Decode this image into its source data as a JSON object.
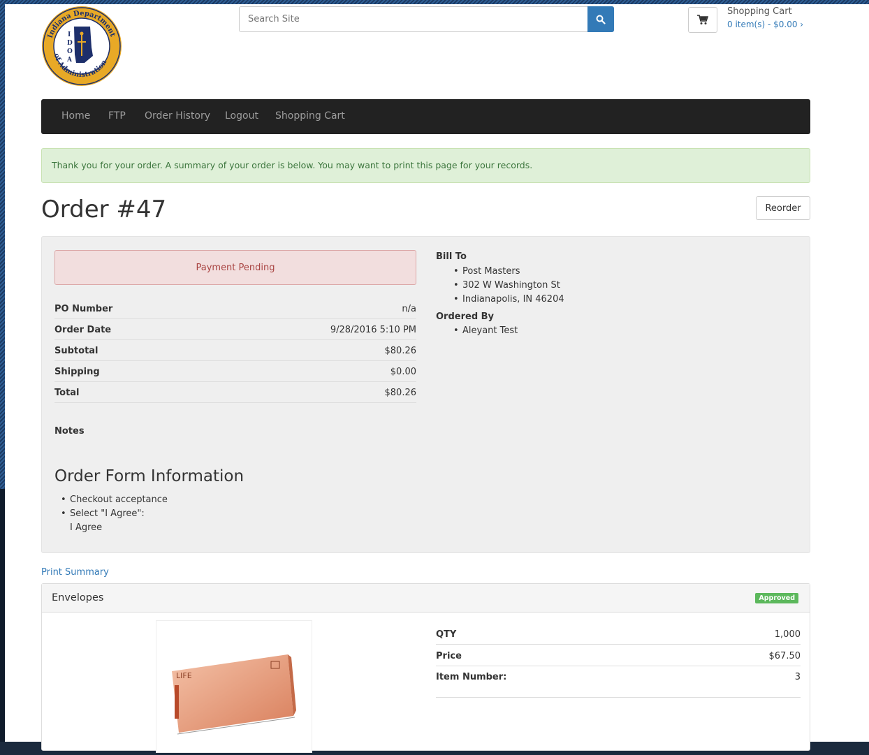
{
  "header": {
    "search_placeholder": "Search Site",
    "cart_title": "Shopping Cart",
    "cart_summary": "0 item(s) - $0.00 ›",
    "logo_text": "Indiana Department of Administration IDOA"
  },
  "nav": {
    "items": [
      {
        "label": "Home"
      },
      {
        "label": "FTP"
      },
      {
        "label": "Order History"
      },
      {
        "label": "Logout"
      },
      {
        "label": "Shopping Cart"
      }
    ]
  },
  "alert": {
    "message": "Thank you for your order. A summary of your order is below. You may want to print this page for your records."
  },
  "order": {
    "title": "Order #47",
    "reorder_label": "Reorder",
    "status": "Payment Pending",
    "details": [
      {
        "label": "PO Number",
        "value": "n/a"
      },
      {
        "label": "Order Date",
        "value": "9/28/2016 5:10 PM"
      },
      {
        "label": "Subtotal",
        "value": "$80.26"
      },
      {
        "label": "Shipping",
        "value": "$0.00"
      },
      {
        "label": "Total",
        "value": "$80.26"
      }
    ],
    "notes_label": "Notes",
    "bill_to": {
      "heading": "Bill To",
      "lines": [
        "Post Masters",
        "302 W Washington St",
        "Indianapolis, IN 46204"
      ]
    },
    "ordered_by": {
      "heading": "Ordered By",
      "lines": [
        "Aleyant Test"
      ]
    },
    "form_info": {
      "heading": "Order Form Information",
      "item1": "Checkout acceptance",
      "item2": "Select \"I Agree\":",
      "item2_value": "I Agree"
    }
  },
  "print_summary_label": "Print Summary",
  "item": {
    "name": "Envelopes",
    "badge": "Approved",
    "thumb_text": "LIFE",
    "rows": [
      {
        "label": "QTY",
        "value": "1,000"
      },
      {
        "label": "Price",
        "value": "$67.50"
      },
      {
        "label": "Item Number:",
        "value": "3"
      }
    ]
  },
  "colors": {
    "nav_bg": "#222222",
    "link": "#337ab7",
    "success_bg": "#dff0d8",
    "danger_bg": "#f2dede",
    "badge_green": "#5cb85c"
  }
}
